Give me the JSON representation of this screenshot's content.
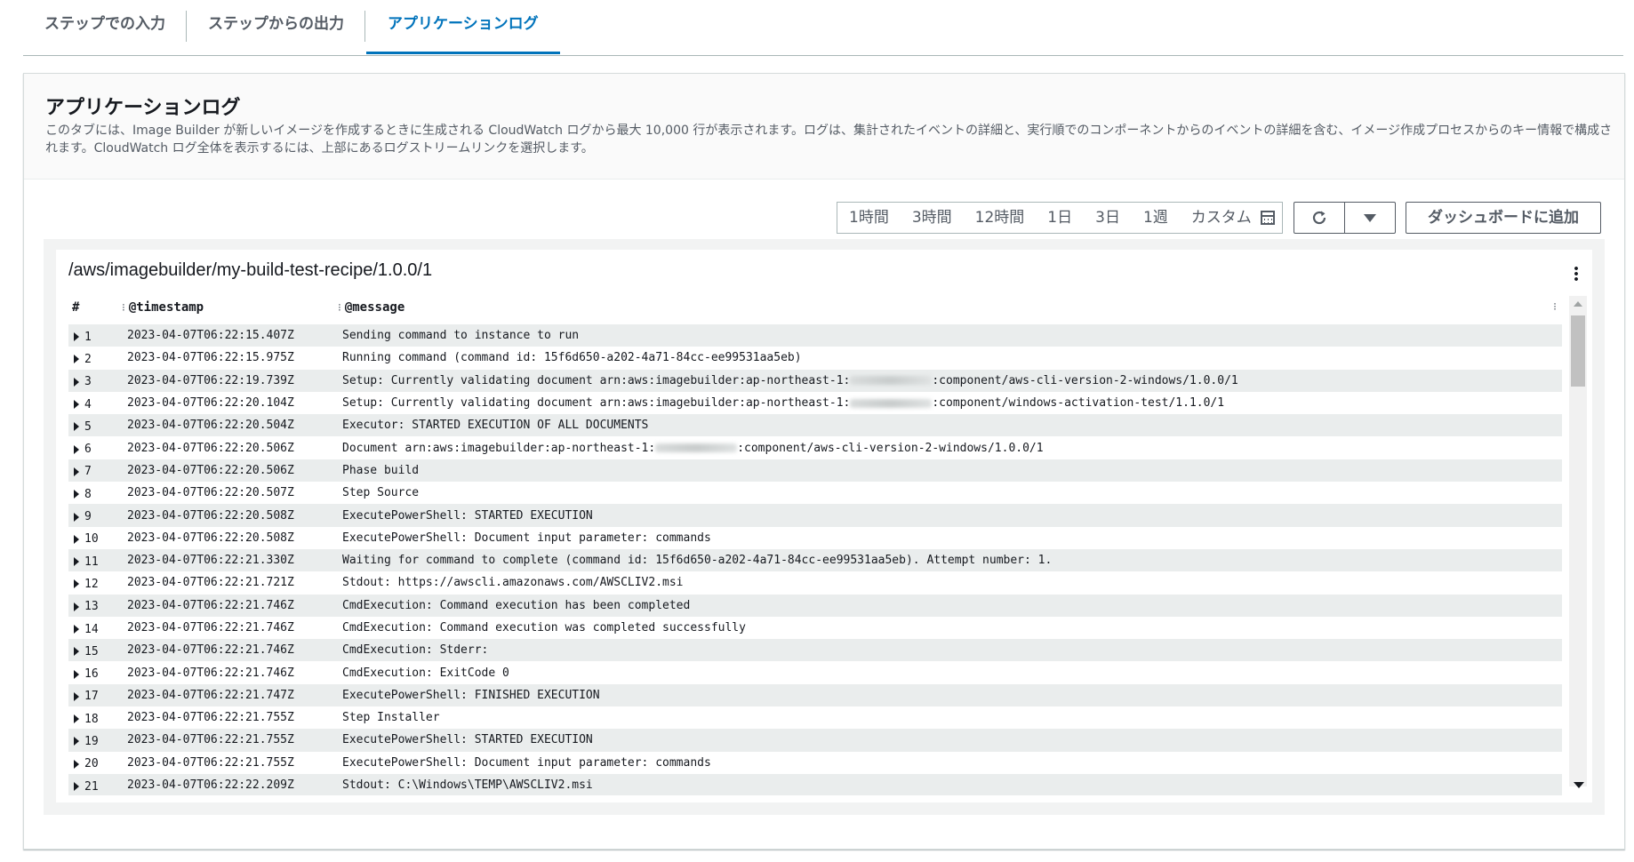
{
  "tabs": [
    {
      "label": "ステップでの入力"
    },
    {
      "label": "ステップからの出力"
    },
    {
      "label": "アプリケーションログ"
    }
  ],
  "panel": {
    "title": "アプリケーションログ",
    "description": "このタブには、Image Builder が新しいイメージを作成するときに生成される CloudWatch ログから最大 10,000 行が表示されます。ログは、集計されたイベントの詳細と、実行順でのコンポーネントからのイベントの詳細を含む、イメージ作成プロセスからのキー情報で構成されます。CloudWatch ログ全体を表示するには、上部にあるログストリームリンクを選択します。"
  },
  "toolbar": {
    "time_ranges": [
      "1時間",
      "3時間",
      "12時間",
      "1日",
      "3日",
      "1週"
    ],
    "custom_label": "カスタム",
    "add_dashboard_label": "ダッシュボードに追加"
  },
  "log": {
    "path": "/aws/imagebuilder/my-build-test-recipe/1.0.0/1",
    "columns": {
      "num": "#",
      "timestamp": "@timestamp",
      "message": "@message"
    },
    "rows": [
      {
        "num": "1",
        "ts": "2023-04-07T06:22:15.407Z",
        "msg": "Sending command to instance to run"
      },
      {
        "num": "2",
        "ts": "2023-04-07T06:22:15.975Z",
        "msg": "Running command (command id: 15f6d650-a202-4a71-84cc-ee99531aa5eb)"
      },
      {
        "num": "3",
        "ts": "2023-04-07T06:22:19.739Z",
        "msg": "Setup: Currently validating document arn:aws:imagebuilder:ap-northeast-1:",
        "redacted": true,
        "msg_after": ":component/aws-cli-version-2-windows/1.0.0/1"
      },
      {
        "num": "4",
        "ts": "2023-04-07T06:22:20.104Z",
        "msg": "Setup: Currently validating document arn:aws:imagebuilder:ap-northeast-1:",
        "redacted": true,
        "msg_after": ":component/windows-activation-test/1.1.0/1"
      },
      {
        "num": "5",
        "ts": "2023-04-07T06:22:20.504Z",
        "msg": "Executor: STARTED EXECUTION OF ALL DOCUMENTS"
      },
      {
        "num": "6",
        "ts": "2023-04-07T06:22:20.506Z",
        "msg": "Document arn:aws:imagebuilder:ap-northeast-1:",
        "redacted": true,
        "msg_after": ":component/aws-cli-version-2-windows/1.0.0/1"
      },
      {
        "num": "7",
        "ts": "2023-04-07T06:22:20.506Z",
        "msg": "Phase build"
      },
      {
        "num": "8",
        "ts": "2023-04-07T06:22:20.507Z",
        "msg": "Step Source"
      },
      {
        "num": "9",
        "ts": "2023-04-07T06:22:20.508Z",
        "msg": "ExecutePowerShell: STARTED EXECUTION"
      },
      {
        "num": "10",
        "ts": "2023-04-07T06:22:20.508Z",
        "msg": "ExecutePowerShell: Document input parameter: commands"
      },
      {
        "num": "11",
        "ts": "2023-04-07T06:22:21.330Z",
        "msg": "Waiting for command to complete (command id: 15f6d650-a202-4a71-84cc-ee99531aa5eb). Attempt number: 1."
      },
      {
        "num": "12",
        "ts": "2023-04-07T06:22:21.721Z",
        "msg": "Stdout: https://awscli.amazonaws.com/AWSCLIV2.msi"
      },
      {
        "num": "13",
        "ts": "2023-04-07T06:22:21.746Z",
        "msg": "CmdExecution: Command execution has been completed"
      },
      {
        "num": "14",
        "ts": "2023-04-07T06:22:21.746Z",
        "msg": "CmdExecution: Command execution was completed successfully"
      },
      {
        "num": "15",
        "ts": "2023-04-07T06:22:21.746Z",
        "msg": "CmdExecution: Stderr:"
      },
      {
        "num": "16",
        "ts": "2023-04-07T06:22:21.746Z",
        "msg": "CmdExecution: ExitCode 0"
      },
      {
        "num": "17",
        "ts": "2023-04-07T06:22:21.747Z",
        "msg": "ExecutePowerShell: FINISHED EXECUTION"
      },
      {
        "num": "18",
        "ts": "2023-04-07T06:22:21.755Z",
        "msg": "Step Installer"
      },
      {
        "num": "19",
        "ts": "2023-04-07T06:22:21.755Z",
        "msg": "ExecutePowerShell: STARTED EXECUTION"
      },
      {
        "num": "20",
        "ts": "2023-04-07T06:22:21.755Z",
        "msg": "ExecutePowerShell: Document input parameter: commands"
      },
      {
        "num": "21",
        "ts": "2023-04-07T06:22:22.209Z",
        "msg": "Stdout: C:\\Windows\\TEMP\\AWSCLIV2.msi"
      }
    ]
  }
}
